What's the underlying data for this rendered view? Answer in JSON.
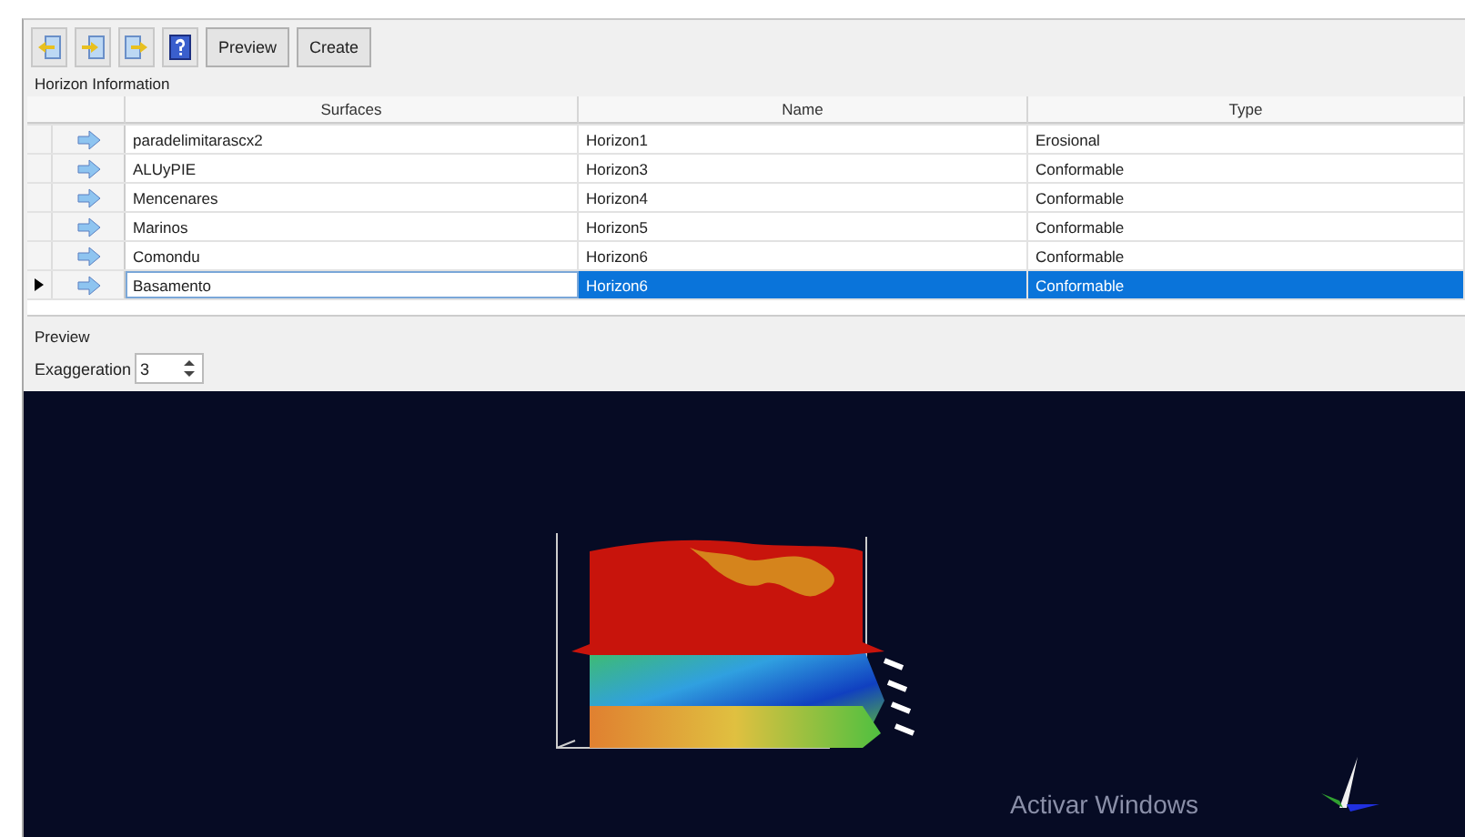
{
  "toolbar": {
    "buttons": [
      {
        "kind": "icon"
      },
      {
        "kind": "icon"
      },
      {
        "kind": "icon"
      },
      {
        "kind": "icon"
      },
      {
        "kind": "text",
        "label": "Preview"
      },
      {
        "kind": "text",
        "label": "Create"
      }
    ]
  },
  "horizon_information": {
    "title": "Horizon Information",
    "columns": [
      "Surfaces",
      "Name",
      "Type"
    ],
    "rows": [
      {
        "surface": "paradelimitarascx2",
        "name": "Horizon1",
        "type": "Erosional",
        "selected": false
      },
      {
        "surface": "ALUyPIE",
        "name": "Horizon3",
        "type": "Conformable",
        "selected": false
      },
      {
        "surface": "Mencenares",
        "name": "Horizon4",
        "type": "Conformable",
        "selected": false
      },
      {
        "surface": "Marinos",
        "name": "Horizon5",
        "type": "Conformable",
        "selected": false
      },
      {
        "surface": "Comondu",
        "name": "Horizon6",
        "type": "Conformable",
        "selected": false
      },
      {
        "surface": "Basamento",
        "name": "Horizon6",
        "type": "Conformable",
        "selected": true
      }
    ]
  },
  "preview": {
    "title": "Preview",
    "exaggeration_label": "Exaggeration",
    "exaggeration_value": "3"
  },
  "os_notice": "Activar Windows"
}
